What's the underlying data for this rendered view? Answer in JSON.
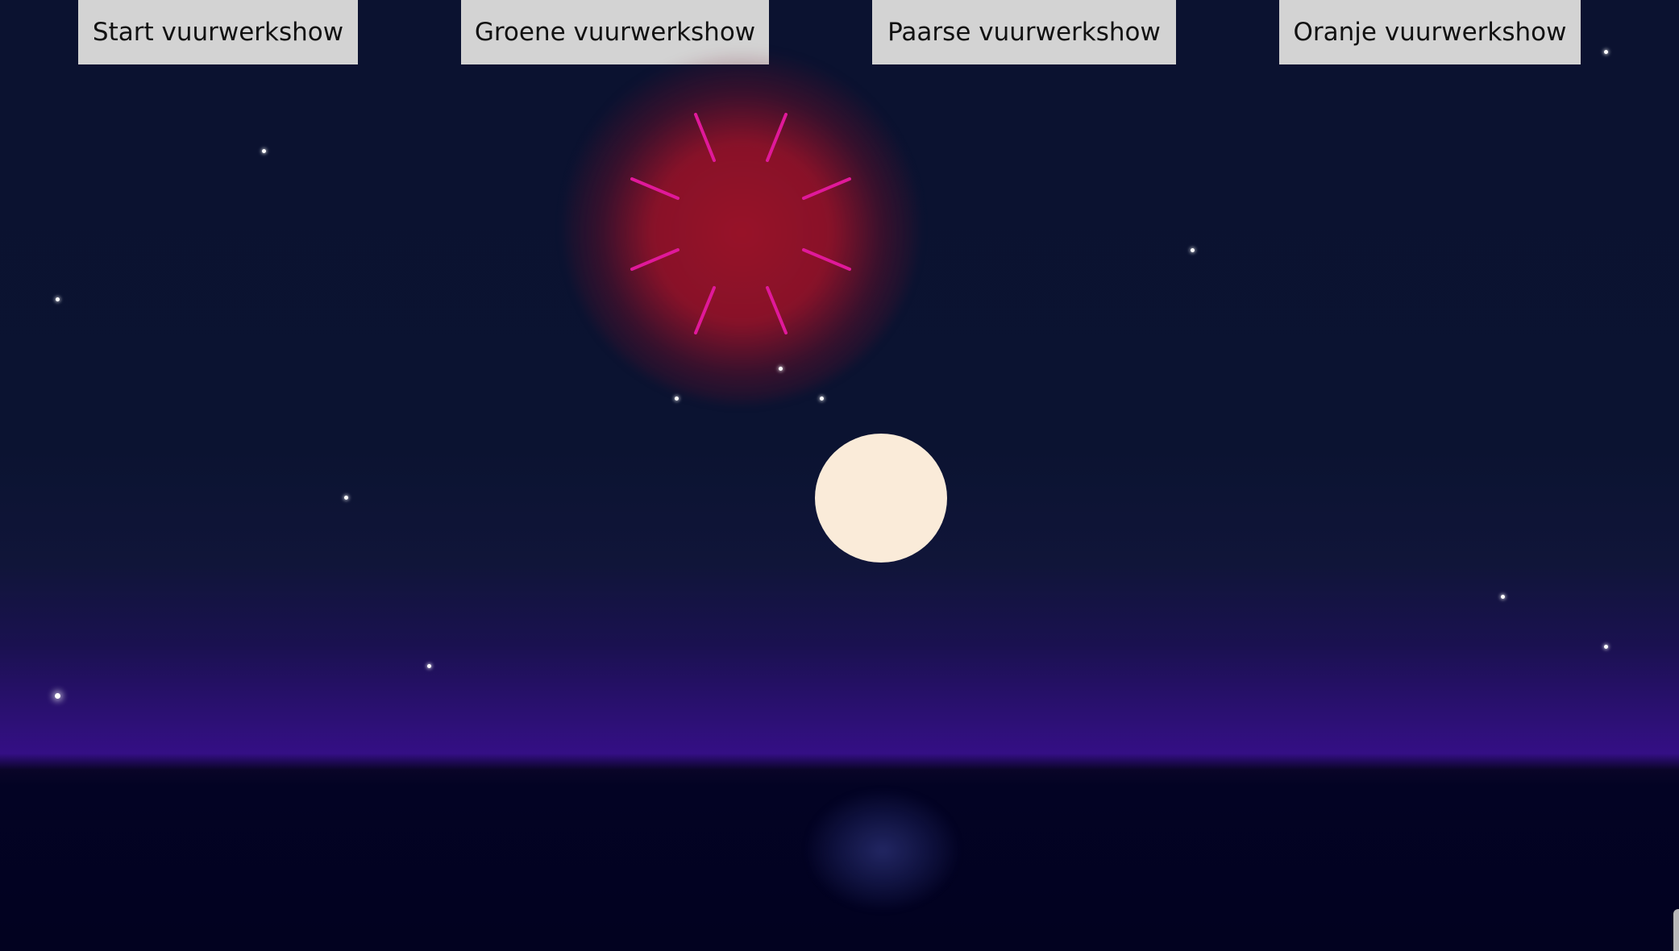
{
  "buttons": {
    "start": "Start vuurwerkshow",
    "green": "Groene vuurwerkshow",
    "purple": "Paarse vuurwerkshow",
    "orange": "Oranje vuurwerkshow"
  },
  "colors": {
    "sky": "#0b1230",
    "horizon": "#340f85",
    "water": "#020220",
    "moon": "#faebd9",
    "firework_glow": "#9a1228",
    "firework_rays": "#e0199a",
    "button_bg": "#d3d3d3"
  },
  "icons": {
    "firework": "firework-burst",
    "moon": "full-moon"
  }
}
